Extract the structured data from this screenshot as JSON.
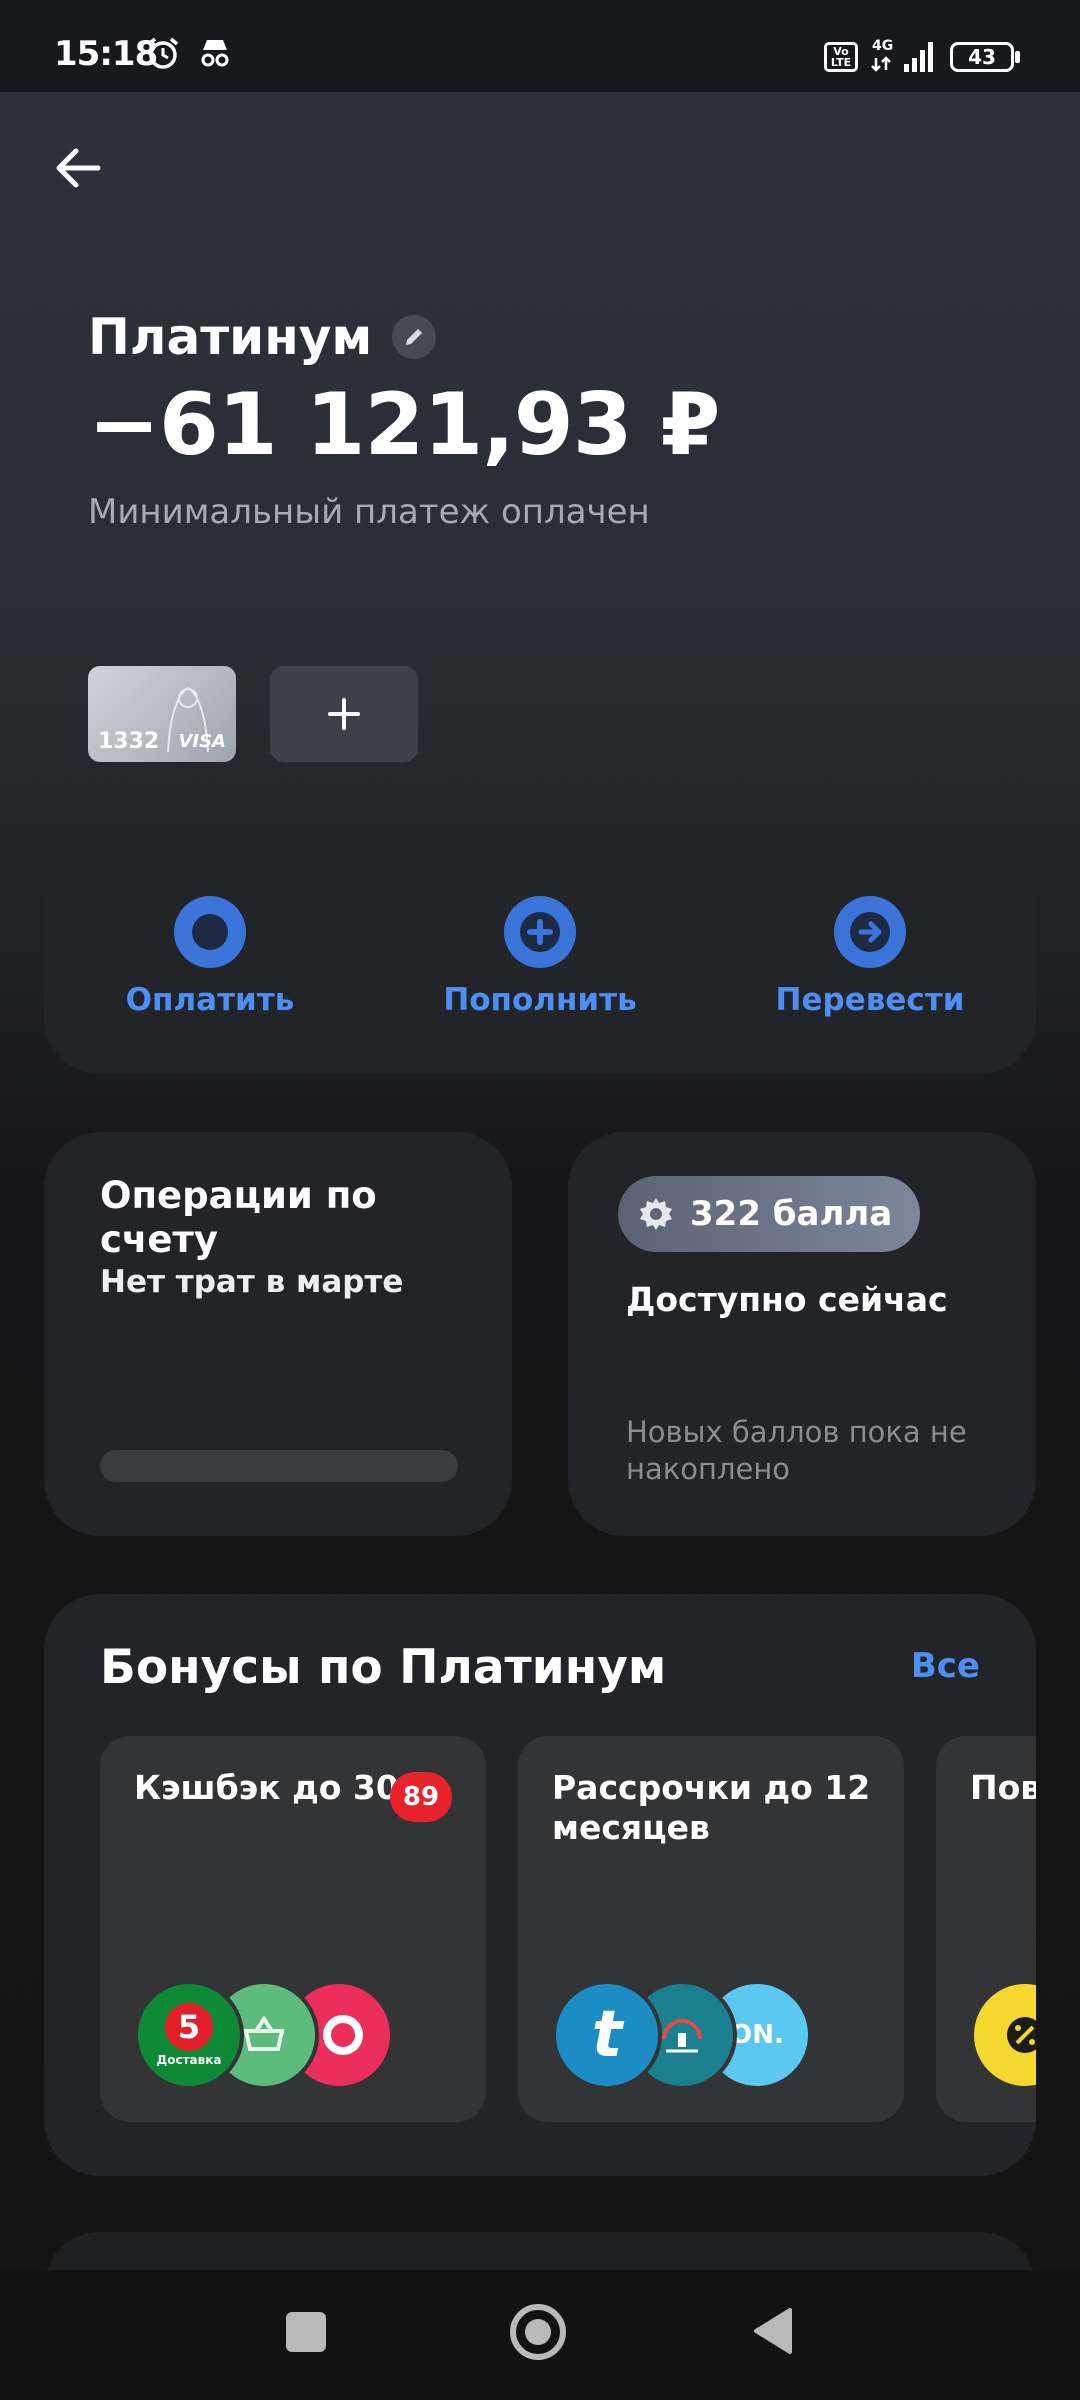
{
  "status_bar": {
    "time": "15:18",
    "volte": "Vo\nLTE",
    "network": "4G",
    "battery": "43"
  },
  "account": {
    "title": "Платинум",
    "balance": "−61 121,93 ₽",
    "status": "Минимальный платеж оплачен",
    "card_last4": "1332",
    "card_brand": "VISA"
  },
  "actions": [
    {
      "label": "Оплатить",
      "icon": "circle-icon"
    },
    {
      "label": "Пополнить",
      "icon": "plus-icon"
    },
    {
      "label": "Перевести",
      "icon": "arrow-right-icon"
    }
  ],
  "operations": {
    "title": "Операции по счету",
    "subtitle": "Нет трат в марте"
  },
  "points": {
    "badge": "322 балла",
    "available": "Доступно сейчас",
    "note": "Новых баллов пока не накоплено"
  },
  "bonuses": {
    "title": "Бонусы по Платинум",
    "all_link": "Все",
    "tiles": [
      {
        "title": "Кэшбэк до 30%",
        "badge": "89"
      },
      {
        "title": "Рассрочки до 12 месяцев",
        "logo_text": "ON."
      },
      {
        "title": "Пов кэш"
      }
    ],
    "logo_texts": {
      "pyaterochka": "5",
      "pyaterochka_caption": "Доставка",
      "t": "t"
    }
  },
  "colors": {
    "accent": "#4d8ff5",
    "action_circle": "#3a74d8",
    "badge_red": "#e8232c"
  }
}
